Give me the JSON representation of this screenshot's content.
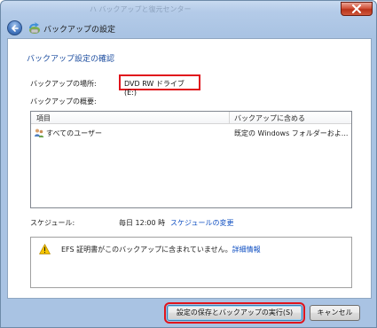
{
  "window": {
    "ghost_title": "ハ    バックアップと復元センター",
    "header_title": "バックアップの設定"
  },
  "page": {
    "title": "バックアップ設定の確認",
    "location_label": "バックアップの場所:",
    "location_value": "DVD RW ドライブ (E:)",
    "summary_label": "バックアップの概要:"
  },
  "list": {
    "columns": [
      "項目",
      "バックアップに含める"
    ],
    "rows": [
      {
        "item": "すべてのユーザー",
        "included": "既定の Windows フォルダーおよ..."
      }
    ]
  },
  "schedule": {
    "label": "スケジュール:",
    "value": "毎日 12:00 時",
    "change_link": "スケジュールの変更"
  },
  "warning": {
    "text": "EFS 証明書がこのバックアップに含まれていません。",
    "link": "詳細情報"
  },
  "buttons": {
    "save_run": "設定の保存とバックアップの実行(S)",
    "cancel": "キャンセル"
  },
  "colors": {
    "accent_title": "#1f4fa0",
    "link": "#0f4fc2",
    "highlight": "#e0141c"
  },
  "icons": [
    "back-arrow-icon",
    "backup-app-icon",
    "users-icon",
    "warning-icon",
    "close-icon"
  ]
}
